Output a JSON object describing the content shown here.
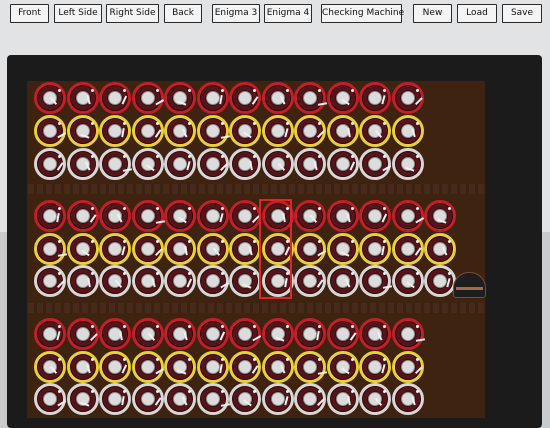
{
  "toolbar": {
    "front": "Front",
    "left_side": "Left Side",
    "right_side": "Right Side",
    "back": "Back",
    "enigma3": "Enigma 3",
    "enigma4": "Enigma 4",
    "checking_machine": "Checking Machine",
    "new": "New",
    "load": "Load",
    "save": "Save"
  },
  "colors": {
    "ring_red": "#c21f2a",
    "ring_yellow": "#e9cf3a",
    "ring_white": "#d9d6d6",
    "selector": "#e0242c",
    "panel": "#3f2311"
  },
  "icons": {
    "drum": "rotor-drum-icon",
    "indicator": "indicator-dome-icon"
  },
  "drum_groups": [
    {
      "name": "upper-bank",
      "columns": 12,
      "ring_order": [
        "red",
        "yellow",
        "white"
      ]
    },
    {
      "name": "middle-bank",
      "columns": 13,
      "ring_order": [
        "red",
        "yellow",
        "white"
      ],
      "selected_column": 8
    },
    {
      "name": "lower-bank",
      "columns": 12,
      "ring_order": [
        "red",
        "yellow",
        "white"
      ]
    }
  ]
}
